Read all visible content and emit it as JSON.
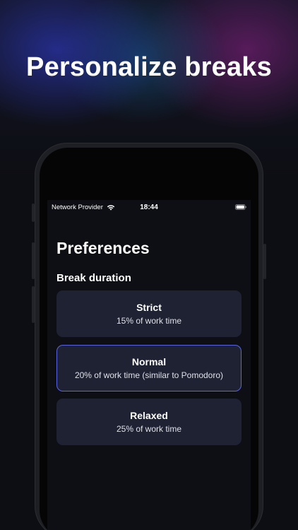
{
  "headline": "Personalize breaks",
  "status_bar": {
    "carrier": "Network Provider",
    "time": "18:44"
  },
  "screen": {
    "title": "Preferences",
    "section_label": "Break duration",
    "options": [
      {
        "title": "Strict",
        "description": "15% of work time",
        "selected": false
      },
      {
        "title": "Normal",
        "description": "20% of work time (similar to Pomodoro)",
        "selected": true
      },
      {
        "title": "Relaxed",
        "description": "25% of work time",
        "selected": false
      }
    ]
  },
  "colors": {
    "accent": "#5a64e6",
    "card": "#1f2233",
    "background": "#0e0f14"
  }
}
